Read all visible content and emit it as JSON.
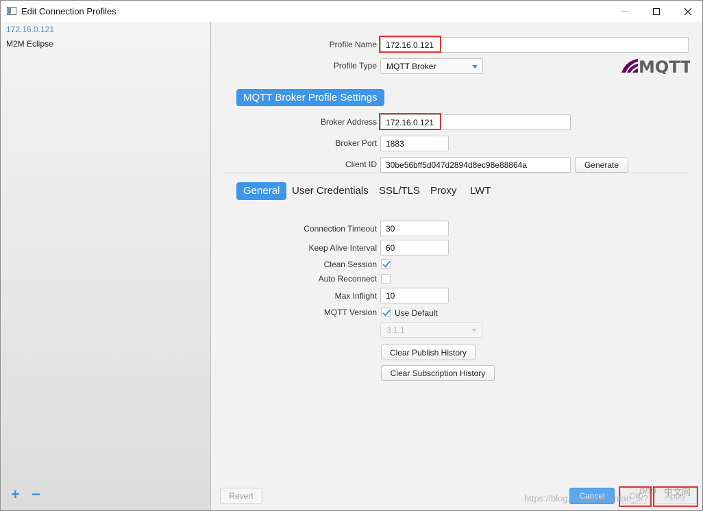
{
  "window": {
    "title": "Edit Connection Profiles"
  },
  "sidebar": {
    "profiles": [
      "172.16.0.121",
      "M2M Eclipse"
    ],
    "add_label": "+",
    "remove_label": "−"
  },
  "profile": {
    "name_label": "Profile Name",
    "name_value": "172.16.0.121",
    "type_label": "Profile Type",
    "type_value": "MQTT Broker",
    "logo_text": "MQTT"
  },
  "broker": {
    "section_title": "MQTT Broker Profile Settings",
    "address_label": "Broker Address",
    "address_value": "172.16.0.121",
    "port_label": "Broker Port",
    "port_value": "1883",
    "client_id_label": "Client ID",
    "client_id_value": "30be56bff5d047d2894d8ec98e88864a",
    "generate_label": "Generate"
  },
  "tabs": [
    "General",
    "User Credentials",
    "SSL/TLS",
    "Proxy",
    "LWT"
  ],
  "general": {
    "connection_timeout_label": "Connection Timeout",
    "connection_timeout_value": "30",
    "keep_alive_label": "Keep Alive Interval",
    "keep_alive_value": "60",
    "clean_session_label": "Clean Session",
    "clean_session_checked": true,
    "auto_reconnect_label": "Auto Reconnect",
    "auto_reconnect_checked": false,
    "max_inflight_label": "Max Inflight",
    "max_inflight_value": "10",
    "mqtt_version_label": "MQTT Version",
    "use_default_label": "Use Default",
    "use_default_checked": true,
    "version_value": "3.1.1",
    "clear_publish_label": "Clear Publish History",
    "clear_subscription_label": "Clear Subscription History"
  },
  "footer": {
    "revert_label": "Revert",
    "cancel_label": "Cancel",
    "ok_label": "OK",
    "apply_label": "Apply"
  },
  "watermark": {
    "url": "https://blog.csdn.net/fanfan_s/?",
    "php_text": "php",
    "cn_text": "中文网"
  },
  "colors": {
    "accent": "#3d96ea",
    "highlight": "#e03333"
  }
}
